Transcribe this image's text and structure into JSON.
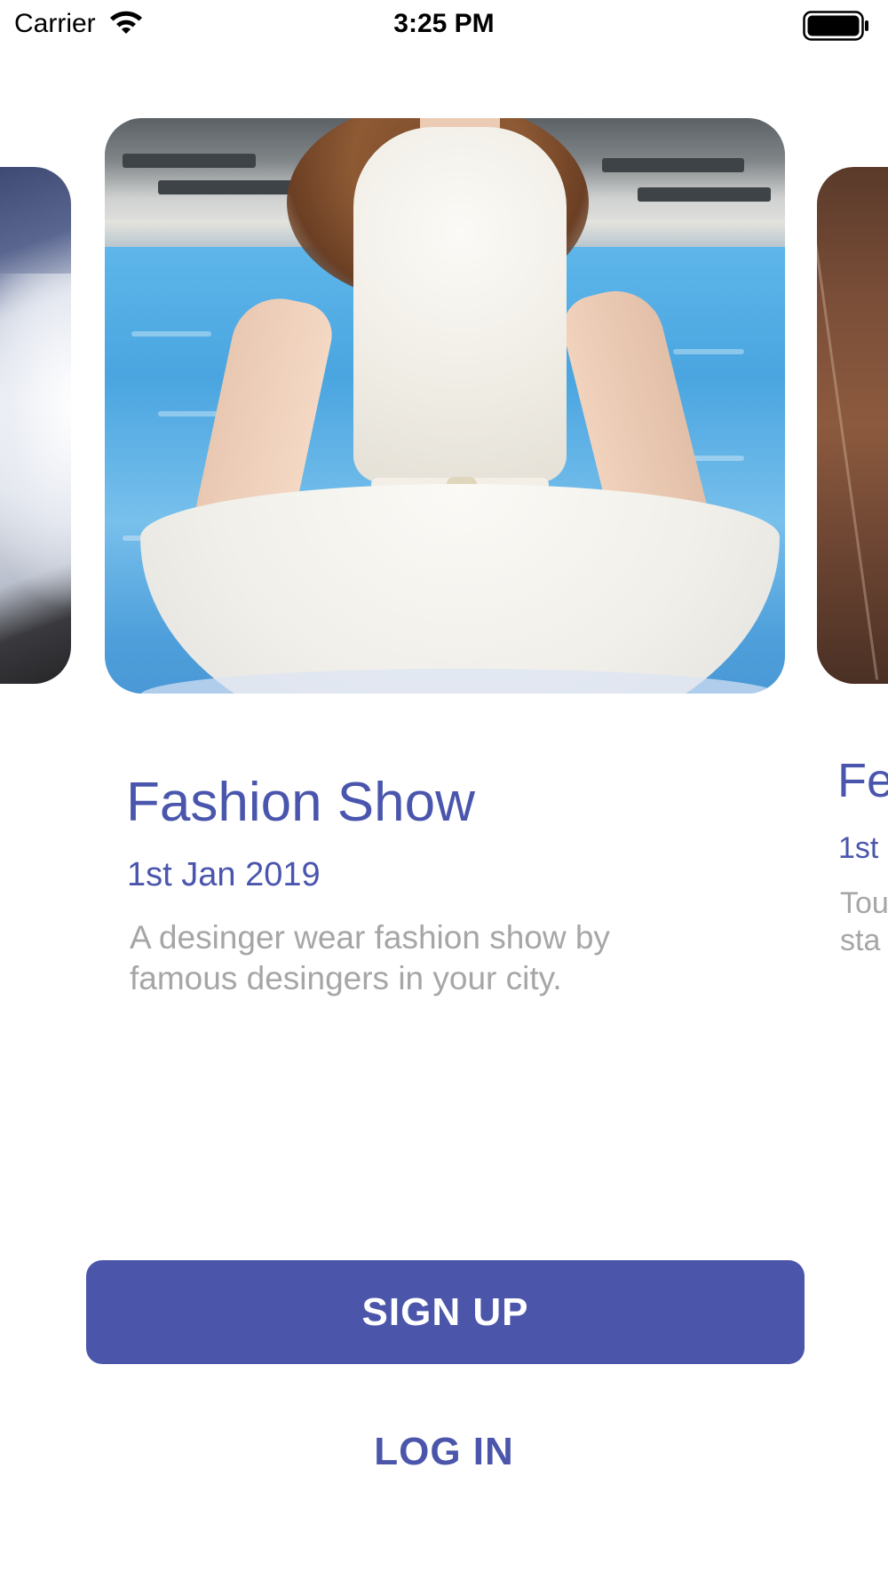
{
  "status_bar": {
    "carrier": "Carrier",
    "time": "3:25 PM",
    "icons": [
      "wifi-icon",
      "battery-icon"
    ]
  },
  "carousel": {
    "prev_card": {
      "image": "snowy-mountain-photo"
    },
    "current_card": {
      "image": "white-dress-poolside-photo",
      "title": "Fashion Show",
      "date": "1st Jan 2019",
      "description": "A desinger wear fashion show by famous desingers in your city."
    },
    "next_card": {
      "image": "autumn-forest-photo",
      "title_partial": "Fe",
      "date_partial": "1st",
      "description_partial_line1": "Tou",
      "description_partial_line2": "sta"
    }
  },
  "actions": {
    "signup_label": "SIGN UP",
    "login_label": "LOG IN"
  },
  "colors": {
    "accent": "#4b56ab",
    "muted_text": "#a6a6a6",
    "background": "#ffffff"
  }
}
